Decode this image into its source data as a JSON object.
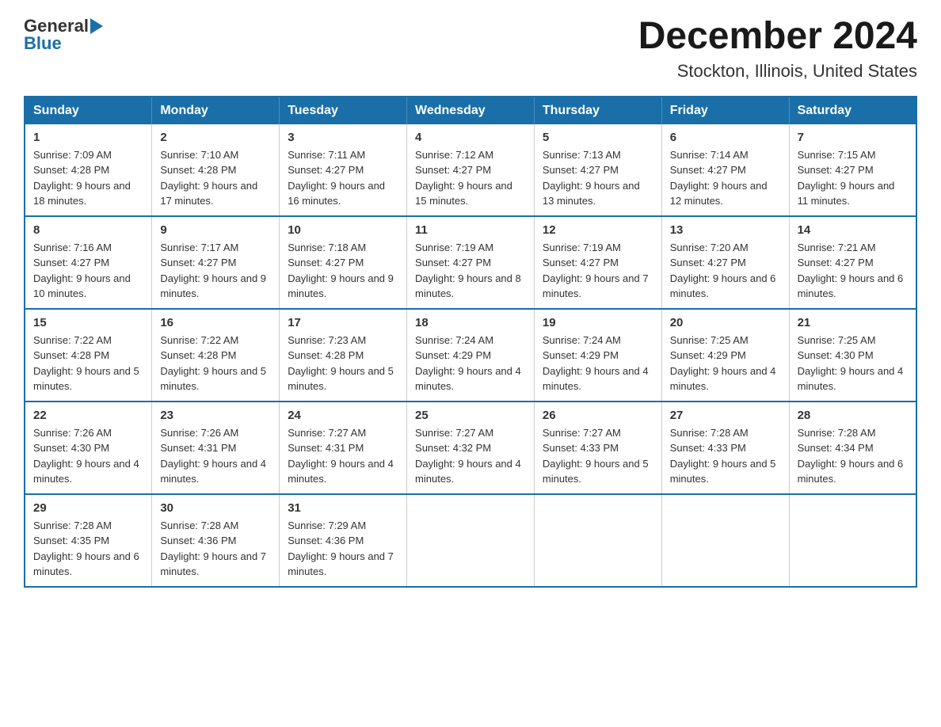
{
  "header": {
    "logo_general": "General",
    "logo_blue": "Blue",
    "month_title": "December 2024",
    "location": "Stockton, Illinois, United States"
  },
  "days_of_week": [
    "Sunday",
    "Monday",
    "Tuesday",
    "Wednesday",
    "Thursday",
    "Friday",
    "Saturday"
  ],
  "weeks": [
    [
      {
        "day": "1",
        "sunrise": "Sunrise: 7:09 AM",
        "sunset": "Sunset: 4:28 PM",
        "daylight": "Daylight: 9 hours and 18 minutes."
      },
      {
        "day": "2",
        "sunrise": "Sunrise: 7:10 AM",
        "sunset": "Sunset: 4:28 PM",
        "daylight": "Daylight: 9 hours and 17 minutes."
      },
      {
        "day": "3",
        "sunrise": "Sunrise: 7:11 AM",
        "sunset": "Sunset: 4:27 PM",
        "daylight": "Daylight: 9 hours and 16 minutes."
      },
      {
        "day": "4",
        "sunrise": "Sunrise: 7:12 AM",
        "sunset": "Sunset: 4:27 PM",
        "daylight": "Daylight: 9 hours and 15 minutes."
      },
      {
        "day": "5",
        "sunrise": "Sunrise: 7:13 AM",
        "sunset": "Sunset: 4:27 PM",
        "daylight": "Daylight: 9 hours and 13 minutes."
      },
      {
        "day": "6",
        "sunrise": "Sunrise: 7:14 AM",
        "sunset": "Sunset: 4:27 PM",
        "daylight": "Daylight: 9 hours and 12 minutes."
      },
      {
        "day": "7",
        "sunrise": "Sunrise: 7:15 AM",
        "sunset": "Sunset: 4:27 PM",
        "daylight": "Daylight: 9 hours and 11 minutes."
      }
    ],
    [
      {
        "day": "8",
        "sunrise": "Sunrise: 7:16 AM",
        "sunset": "Sunset: 4:27 PM",
        "daylight": "Daylight: 9 hours and 10 minutes."
      },
      {
        "day": "9",
        "sunrise": "Sunrise: 7:17 AM",
        "sunset": "Sunset: 4:27 PM",
        "daylight": "Daylight: 9 hours and 9 minutes."
      },
      {
        "day": "10",
        "sunrise": "Sunrise: 7:18 AM",
        "sunset": "Sunset: 4:27 PM",
        "daylight": "Daylight: 9 hours and 9 minutes."
      },
      {
        "day": "11",
        "sunrise": "Sunrise: 7:19 AM",
        "sunset": "Sunset: 4:27 PM",
        "daylight": "Daylight: 9 hours and 8 minutes."
      },
      {
        "day": "12",
        "sunrise": "Sunrise: 7:19 AM",
        "sunset": "Sunset: 4:27 PM",
        "daylight": "Daylight: 9 hours and 7 minutes."
      },
      {
        "day": "13",
        "sunrise": "Sunrise: 7:20 AM",
        "sunset": "Sunset: 4:27 PM",
        "daylight": "Daylight: 9 hours and 6 minutes."
      },
      {
        "day": "14",
        "sunrise": "Sunrise: 7:21 AM",
        "sunset": "Sunset: 4:27 PM",
        "daylight": "Daylight: 9 hours and 6 minutes."
      }
    ],
    [
      {
        "day": "15",
        "sunrise": "Sunrise: 7:22 AM",
        "sunset": "Sunset: 4:28 PM",
        "daylight": "Daylight: 9 hours and 5 minutes."
      },
      {
        "day": "16",
        "sunrise": "Sunrise: 7:22 AM",
        "sunset": "Sunset: 4:28 PM",
        "daylight": "Daylight: 9 hours and 5 minutes."
      },
      {
        "day": "17",
        "sunrise": "Sunrise: 7:23 AM",
        "sunset": "Sunset: 4:28 PM",
        "daylight": "Daylight: 9 hours and 5 minutes."
      },
      {
        "day": "18",
        "sunrise": "Sunrise: 7:24 AM",
        "sunset": "Sunset: 4:29 PM",
        "daylight": "Daylight: 9 hours and 4 minutes."
      },
      {
        "day": "19",
        "sunrise": "Sunrise: 7:24 AM",
        "sunset": "Sunset: 4:29 PM",
        "daylight": "Daylight: 9 hours and 4 minutes."
      },
      {
        "day": "20",
        "sunrise": "Sunrise: 7:25 AM",
        "sunset": "Sunset: 4:29 PM",
        "daylight": "Daylight: 9 hours and 4 minutes."
      },
      {
        "day": "21",
        "sunrise": "Sunrise: 7:25 AM",
        "sunset": "Sunset: 4:30 PM",
        "daylight": "Daylight: 9 hours and 4 minutes."
      }
    ],
    [
      {
        "day": "22",
        "sunrise": "Sunrise: 7:26 AM",
        "sunset": "Sunset: 4:30 PM",
        "daylight": "Daylight: 9 hours and 4 minutes."
      },
      {
        "day": "23",
        "sunrise": "Sunrise: 7:26 AM",
        "sunset": "Sunset: 4:31 PM",
        "daylight": "Daylight: 9 hours and 4 minutes."
      },
      {
        "day": "24",
        "sunrise": "Sunrise: 7:27 AM",
        "sunset": "Sunset: 4:31 PM",
        "daylight": "Daylight: 9 hours and 4 minutes."
      },
      {
        "day": "25",
        "sunrise": "Sunrise: 7:27 AM",
        "sunset": "Sunset: 4:32 PM",
        "daylight": "Daylight: 9 hours and 4 minutes."
      },
      {
        "day": "26",
        "sunrise": "Sunrise: 7:27 AM",
        "sunset": "Sunset: 4:33 PM",
        "daylight": "Daylight: 9 hours and 5 minutes."
      },
      {
        "day": "27",
        "sunrise": "Sunrise: 7:28 AM",
        "sunset": "Sunset: 4:33 PM",
        "daylight": "Daylight: 9 hours and 5 minutes."
      },
      {
        "day": "28",
        "sunrise": "Sunrise: 7:28 AM",
        "sunset": "Sunset: 4:34 PM",
        "daylight": "Daylight: 9 hours and 6 minutes."
      }
    ],
    [
      {
        "day": "29",
        "sunrise": "Sunrise: 7:28 AM",
        "sunset": "Sunset: 4:35 PM",
        "daylight": "Daylight: 9 hours and 6 minutes."
      },
      {
        "day": "30",
        "sunrise": "Sunrise: 7:28 AM",
        "sunset": "Sunset: 4:36 PM",
        "daylight": "Daylight: 9 hours and 7 minutes."
      },
      {
        "day": "31",
        "sunrise": "Sunrise: 7:29 AM",
        "sunset": "Sunset: 4:36 PM",
        "daylight": "Daylight: 9 hours and 7 minutes."
      },
      null,
      null,
      null,
      null
    ]
  ]
}
